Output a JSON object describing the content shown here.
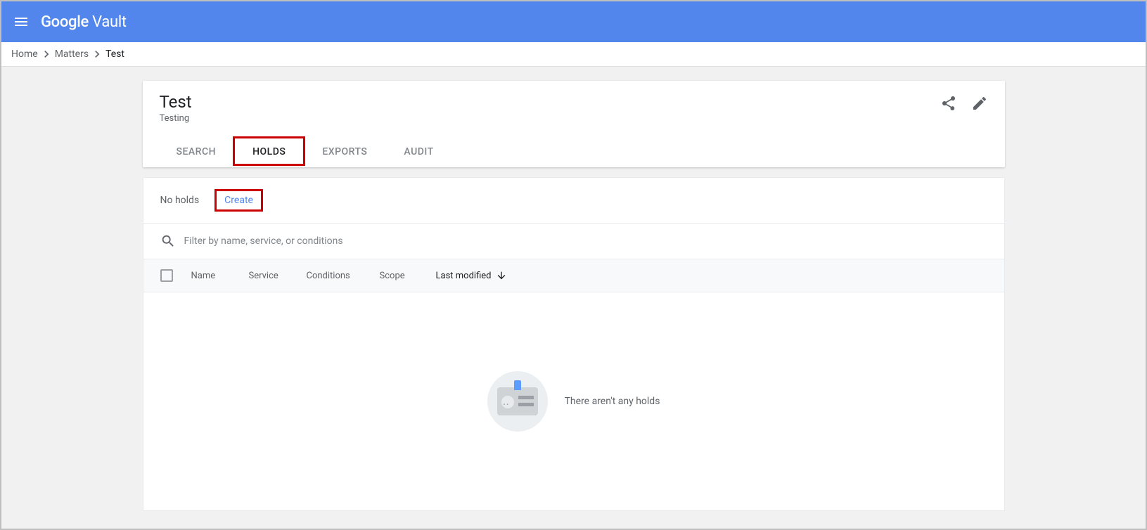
{
  "header": {
    "logo_text_1": "Google",
    "logo_text_2": " Vault"
  },
  "breadcrumb": {
    "items": [
      "Home",
      "Matters",
      "Test"
    ]
  },
  "matter": {
    "title": "Test",
    "subtitle": "Testing"
  },
  "tabs": {
    "search": "SEARCH",
    "holds": "HOLDS",
    "exports": "EXPORTS",
    "audit": "AUDIT"
  },
  "toolbar": {
    "no_holds": "No holds",
    "create": "Create"
  },
  "filter": {
    "placeholder": "Filter by name, service, or conditions"
  },
  "table": {
    "columns": {
      "name": "Name",
      "service": "Service",
      "conditions": "Conditions",
      "scope": "Scope",
      "modified": "Last modified"
    }
  },
  "empty": {
    "message": "There aren't any holds"
  }
}
